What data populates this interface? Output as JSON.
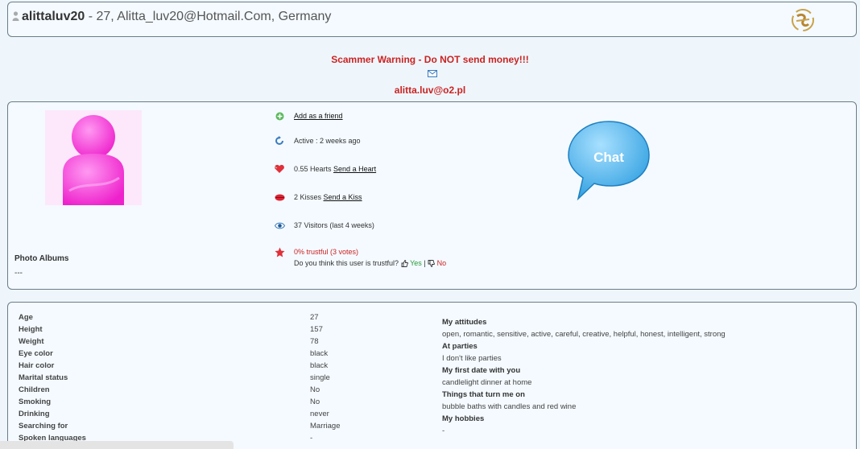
{
  "header": {
    "username": "alittaluv20",
    "info": " - 27, Alitta_luv20@Hotmail.Com, Germany"
  },
  "warning": {
    "text": "Scammer Warning - Do NOT send money!!!",
    "email": "alitta.luv@o2.pl"
  },
  "profile": {
    "photo_albums_label": "Photo Albums",
    "photo_albums_value": "---",
    "add_friend": "Add as a friend",
    "active": "Active : 2 weeks ago",
    "hearts": "0.55 Hearts",
    "send_heart": "Send a Heart",
    "kisses": "2 Kisses",
    "send_kiss": "Send a Kiss",
    "visitors": "37 Visitors (last 4 weeks)",
    "trust": "0% trustful (3 votes)",
    "trust_question": "Do you think this user is trustful?",
    "yes": "Yes",
    "separator": "|",
    "no": "No",
    "chat_label": "Chat"
  },
  "details": {
    "rows": [
      {
        "label": "Age",
        "value": "27"
      },
      {
        "label": "Height",
        "value": "157"
      },
      {
        "label": "Weight",
        "value": "78"
      },
      {
        "label": "Eye color",
        "value": "black"
      },
      {
        "label": "Hair color",
        "value": "black"
      },
      {
        "label": "Marital status",
        "value": "single"
      },
      {
        "label": "Children",
        "value": "No"
      },
      {
        "label": "Smoking",
        "value": "No"
      },
      {
        "label": "Drinking",
        "value": "never"
      },
      {
        "label": "Searching for",
        "value": "Marriage"
      },
      {
        "label": "Spoken languages",
        "value": "-"
      }
    ],
    "qa": [
      {
        "q": "My attitudes",
        "a": "open, romantic, sensitive, active, careful, creative, helpful, honest, intelligent, strong"
      },
      {
        "q": "At parties",
        "a": "I don't like parties"
      },
      {
        "q": "My first date with you",
        "a": "candlelight dinner at home"
      },
      {
        "q": "Things that turn me on",
        "a": "bubble baths with candles and red wine"
      },
      {
        "q": "My hobbies",
        "a": "-"
      }
    ]
  },
  "colors": {
    "accent_red": "#cc2222",
    "border": "#6b7c88",
    "background": "#eef6fb",
    "avatar_pink": "#ff33dd",
    "chat_blue": "#4fb4e8"
  },
  "icons": [
    "user-icon",
    "pisces-zodiac-icon",
    "mail-icon",
    "add-friend-icon",
    "refresh-icon",
    "heart-icon",
    "kiss-icon",
    "eye-icon",
    "star-icon",
    "thumbs-up-icon",
    "thumbs-down-icon",
    "chat-bubble-icon"
  ]
}
